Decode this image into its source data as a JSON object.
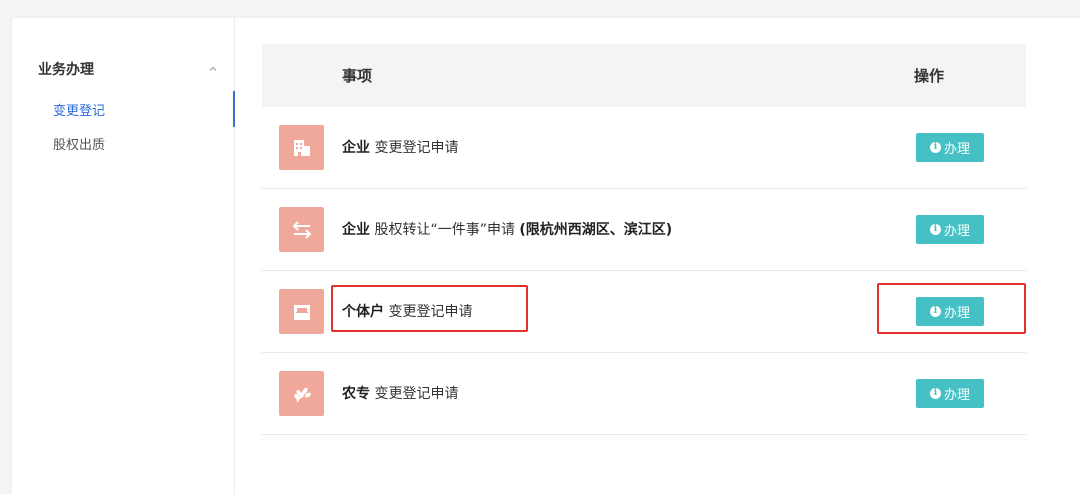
{
  "sidebar": {
    "group_label": "业务办理",
    "items": [
      {
        "label": "变更登记",
        "active": true
      },
      {
        "label": "股权出质",
        "active": false
      }
    ]
  },
  "table": {
    "headers": {
      "matter": "事项",
      "operation": "操作"
    },
    "rows": [
      {
        "icon": "building-icon",
        "bold": "企业",
        "text": " 变更登记申请",
        "suffix": "",
        "button": "办理"
      },
      {
        "icon": "transfer-arrows-icon",
        "bold": "企业",
        "text": " 股权转让“一件事”申请 ",
        "suffix": "(限杭州西湖区、滨江区)",
        "button": "办理"
      },
      {
        "icon": "shop-icon",
        "bold": "个体户",
        "text": " 变更登记申请",
        "suffix": "",
        "button": "办理"
      },
      {
        "icon": "wheat-icon",
        "bold": "农专",
        "text": " 变更登记申请",
        "suffix": "",
        "button": "办理"
      }
    ]
  },
  "colors": {
    "accent_button": "#45c0c5",
    "icon_background": "#f0a89a",
    "active_nav": "#2b6ad8",
    "highlight": "#e0302a"
  }
}
